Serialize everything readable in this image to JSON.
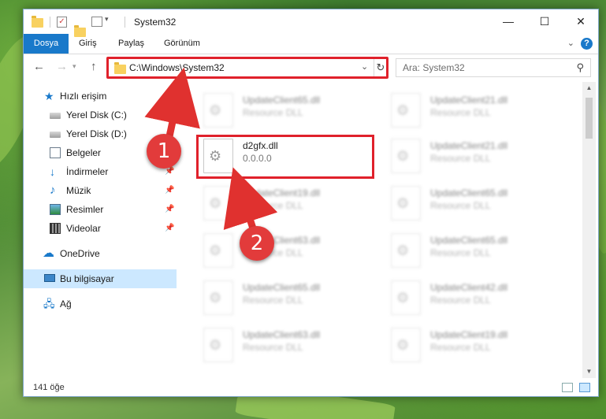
{
  "window": {
    "title": "System32",
    "controls": {
      "minimize": "—",
      "maximize": "☐",
      "close": "✕"
    }
  },
  "ribbon": {
    "tabs": [
      "Dosya",
      "Giriş",
      "Paylaş",
      "Görünüm"
    ],
    "help": "?"
  },
  "navbar": {
    "address": "C:\\Windows\\System32",
    "search_placeholder": "Ara: System32"
  },
  "sidebar": {
    "items": [
      {
        "label": "Hızlı erişim",
        "pinned": false
      },
      {
        "label": "Yerel Disk (C:)",
        "pinned": true
      },
      {
        "label": "Yerel Disk (D:)",
        "pinned": true
      },
      {
        "label": "Belgeler",
        "pinned": true
      },
      {
        "label": "İndirmeler",
        "pinned": true
      },
      {
        "label": "Müzik",
        "pinned": true
      },
      {
        "label": "Resimler",
        "pinned": true
      },
      {
        "label": "Videolar",
        "pinned": true
      },
      {
        "label": "OneDrive",
        "pinned": false
      },
      {
        "label": "Bu bilgisayar",
        "pinned": false,
        "selected": true
      },
      {
        "label": "Ağ",
        "pinned": false
      }
    ]
  },
  "files": [
    {
      "name": "UpdateClient65.dll",
      "desc": "Resource DLL"
    },
    {
      "name": "UpdateClient21.dll",
      "desc": "Resource DLL"
    },
    {
      "name": "d2gfx.dll",
      "desc": "0.0.0.0"
    },
    {
      "name": "UpdateClient21.dll",
      "desc": "Resource DLL"
    },
    {
      "name": "UpdateClient19.dll",
      "desc": "Resource DLL"
    },
    {
      "name": "UpdateClient65.dll",
      "desc": "Resource DLL"
    },
    {
      "name": "UpdateClient63.dll",
      "desc": "Resource DLL"
    },
    {
      "name": "UpdateClient65.dll",
      "desc": "Resource DLL"
    },
    {
      "name": "UpdateClient65.dll",
      "desc": "Resource DLL"
    },
    {
      "name": "UpdateClient42.dll",
      "desc": "Resource DLL"
    },
    {
      "name": "UpdateClient63.dll",
      "desc": "Resource DLL"
    },
    {
      "name": "UpdateClient19.dll",
      "desc": "Resource DLL"
    }
  ],
  "status": {
    "count": "141 öğe"
  },
  "annotations": {
    "step1": "1",
    "step2": "2",
    "color": "#e0212b"
  }
}
